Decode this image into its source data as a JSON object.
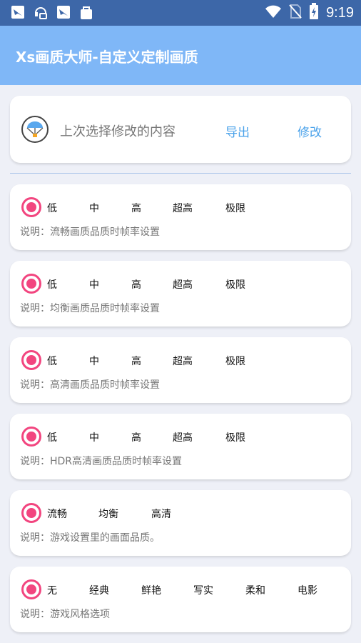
{
  "status_bar": {
    "time": "9:19",
    "left_icons": [
      "app-bird-icon",
      "headset-lock-icon",
      "app-bird-icon",
      "store-bag-icon"
    ],
    "right_icons": [
      "wifi-icon",
      "no-sim-icon",
      "battery-charging-icon"
    ]
  },
  "appbar": {
    "title": "Xs画质大师-自定义定制画质",
    "color": "#7fb7f7"
  },
  "last_choice": {
    "icon": "parachute-icon",
    "label": "上次选择修改的内容",
    "export_label": "导出",
    "modify_label": "修改"
  },
  "cards": [
    {
      "options": [
        "低",
        "中",
        "高",
        "超高",
        "极限"
      ],
      "description": "说明：流畅画质品质时帧率设置"
    },
    {
      "options": [
        "低",
        "中",
        "高",
        "超高",
        "极限"
      ],
      "description": "说明：均衡画质品质时帧率设置"
    },
    {
      "options": [
        "低",
        "中",
        "高",
        "超高",
        "极限"
      ],
      "description": "说明：高清画质品质时帧率设置"
    },
    {
      "options": [
        "低",
        "中",
        "高",
        "超高",
        "极限"
      ],
      "description": "说明：HDR高清画质品质时帧率设置"
    },
    {
      "options": [
        "流畅",
        "均衡",
        "高清"
      ],
      "description": "说明：游戏设置里的画面品质。"
    },
    {
      "options": [
        "无",
        "经典",
        "鲜艳",
        "写实",
        "柔和",
        "电影"
      ],
      "description": "说明：游戏风格选项"
    }
  ],
  "colors": {
    "accent": "#f2457f",
    "link": "#4aa2ea",
    "status_bar": "#3d67a8",
    "background": "#eef0f7"
  }
}
